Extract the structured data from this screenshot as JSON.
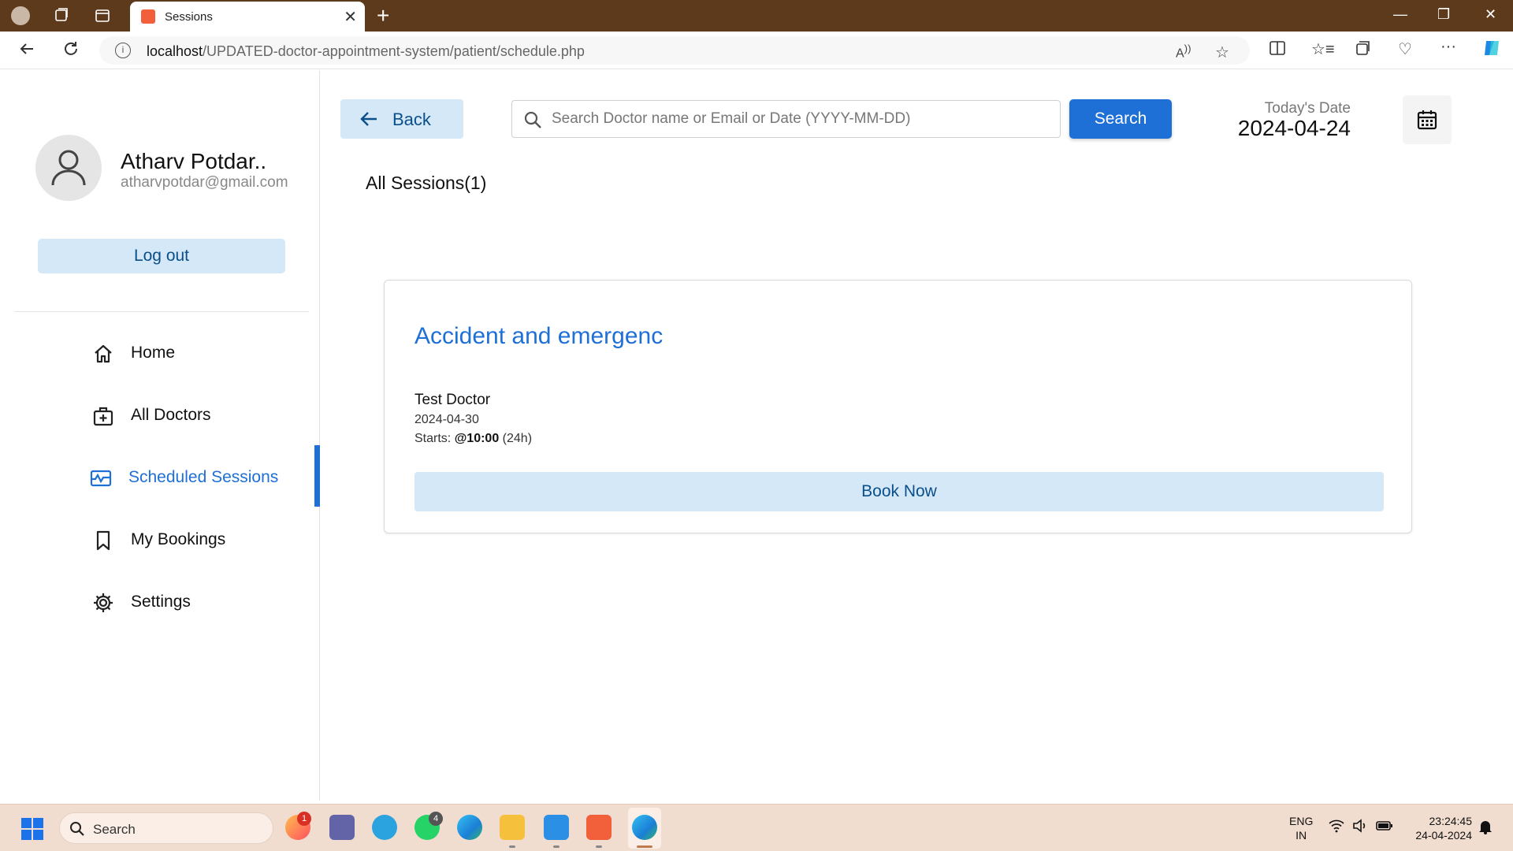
{
  "browser": {
    "tab_title": "Sessions",
    "url_host": "localhost",
    "url_path": "/UPDATED-doctor-appointment-system/patient/schedule.php"
  },
  "profile": {
    "name": "Atharv Potdar..",
    "email": "atharvpotdar@gmail.com",
    "logout_label": "Log out"
  },
  "sidebar": {
    "items": [
      {
        "label": "Home",
        "icon": "home-icon"
      },
      {
        "label": "All Doctors",
        "icon": "doctors-icon"
      },
      {
        "label": "Scheduled Sessions",
        "icon": "sessions-icon",
        "active": true
      },
      {
        "label": "My Bookings",
        "icon": "bookmark-icon"
      },
      {
        "label": "Settings",
        "icon": "gear-icon"
      }
    ]
  },
  "toolbar": {
    "back_label": "Back",
    "search_placeholder": "Search Doctor name or Email or Date (YYYY-MM-DD)",
    "search_label": "Search",
    "date_label": "Today's Date",
    "date_value": "2024-04-24"
  },
  "main": {
    "sessions_title": "All Sessions(1)",
    "sessions": [
      {
        "title": "Accident and emergenc",
        "doctor": "Test Doctor",
        "date": "2024-04-30",
        "starts_prefix": "Starts:",
        "starts_time": "@10:00",
        "starts_suffix": "(24h)",
        "book_label": "Book Now"
      }
    ]
  },
  "taskbar": {
    "search_label": "Search",
    "lang_line1": "ENG",
    "lang_line2": "IN",
    "time": "23:24:45",
    "date": "24-04-2024",
    "badges": {
      "firefox": "1",
      "whatsapp": "4"
    }
  },
  "colors": {
    "accent": "#1e6fd6",
    "button_light": "#d5e8f8",
    "titlebar": "#5e3a1c",
    "taskbar": "#f0ddd0"
  }
}
